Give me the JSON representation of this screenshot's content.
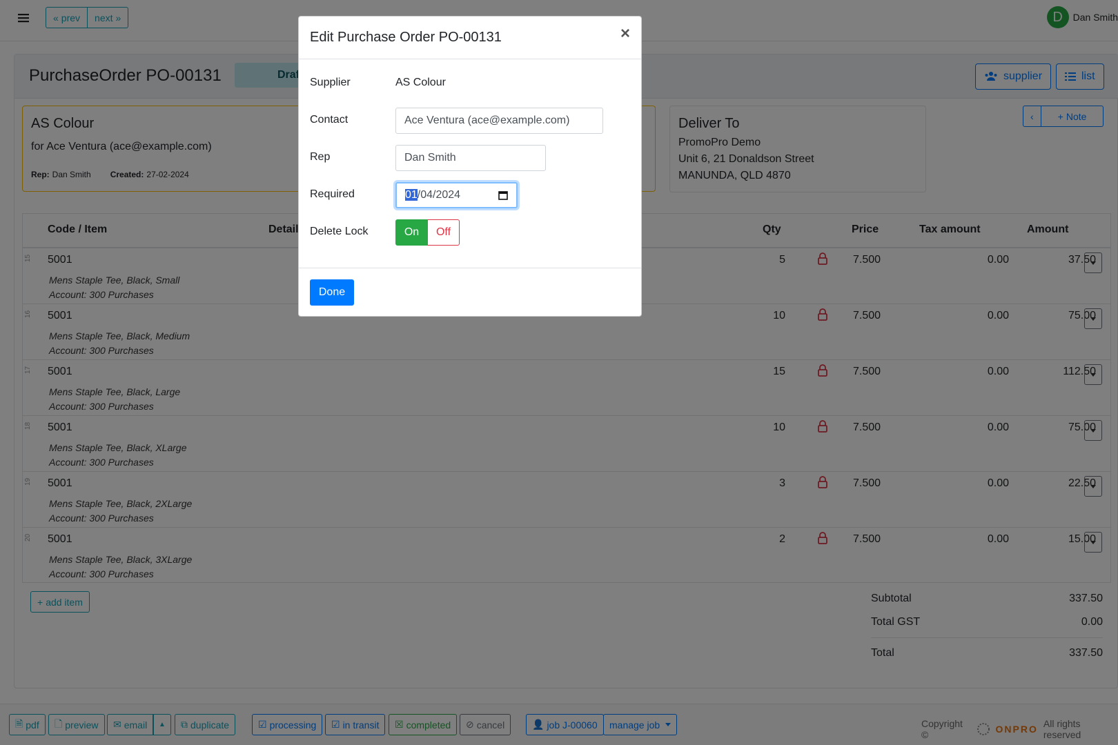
{
  "topbar": {
    "prev_label": "prev",
    "next_label": "next",
    "user_name": "Dan Smith",
    "avatar_letter": "D"
  },
  "page": {
    "title": "PurchaseOrder PO-00131",
    "status": "Draft",
    "supplier_btn": "supplier",
    "list_btn": "list"
  },
  "supplier_card": {
    "name": "AS Colour",
    "for_line": "for Ace Ventura (ace@example.com)",
    "rep_label": "Rep:",
    "rep": "Dan Smith",
    "created_label": "Created:",
    "created": "27-02-2024"
  },
  "deliver_card": {
    "heading": "Deliver To",
    "line1": "PromoPro Demo",
    "line2": "Unit 6, 21 Donaldson Street",
    "line3": "MANUNDA, QLD 4870"
  },
  "note_btn": "Note",
  "table": {
    "headers": {
      "code": "Code / Item",
      "detail": "Detail",
      "qty": "Qty",
      "price": "Price",
      "tax": "Tax amount",
      "amount": "Amount"
    },
    "rows": [
      {
        "num": "15",
        "code": "5001",
        "desc": "Mens Staple Tee, Black, Small",
        "account": "Account: 300 Purchases",
        "qty": "5",
        "price": "7.500",
        "tax": "0.00",
        "amount": "37.50"
      },
      {
        "num": "16",
        "code": "5001",
        "desc": "Mens Staple Tee, Black, Medium",
        "account": "Account: 300 Purchases",
        "qty": "10",
        "price": "7.500",
        "tax": "0.00",
        "amount": "75.00"
      },
      {
        "num": "17",
        "code": "5001",
        "desc": "Mens Staple Tee, Black, Large",
        "account": "Account: 300 Purchases",
        "qty": "15",
        "price": "7.500",
        "tax": "0.00",
        "amount": "112.50"
      },
      {
        "num": "18",
        "code": "5001",
        "desc": "Mens Staple Tee, Black, XLarge",
        "account": "Account: 300 Purchases",
        "qty": "10",
        "price": "7.500",
        "tax": "0.00",
        "amount": "75.00"
      },
      {
        "num": "19",
        "code": "5001",
        "desc": "Mens Staple Tee, Black, 2XLarge",
        "account": "Account: 300 Purchases",
        "qty": "3",
        "price": "7.500",
        "tax": "0.00",
        "amount": "22.50"
      },
      {
        "num": "20",
        "code": "5001",
        "desc": "Mens Staple Tee, Black, 3XLarge",
        "account": "Account: 300 Purchases",
        "qty": "2",
        "price": "7.500",
        "tax": "0.00",
        "amount": "15.00"
      }
    ]
  },
  "add_item_label": "add item",
  "totals": {
    "subtotal_label": "Subtotal",
    "subtotal": "337.50",
    "gst_label": "Total GST",
    "gst": "0.00",
    "total_label": "Total",
    "total": "337.50"
  },
  "footer": {
    "pdf": "pdf",
    "preview": "preview",
    "email": "email",
    "duplicate": "duplicate",
    "processing": "processing",
    "in_transit": "in transit",
    "completed": "completed",
    "cancel": "cancel",
    "job": "job J-00060",
    "manage_job": "manage job",
    "copyright": "Copyright ©",
    "brand": "ONPRO",
    "rights": "All rights reserved"
  },
  "modal": {
    "title": "Edit Purchase Order PO-00131",
    "close": "×",
    "supplier_label": "Supplier",
    "supplier_value": "AS Colour",
    "contact_label": "Contact",
    "contact_value": "Ace Ventura (ace@example.com)",
    "rep_label": "Rep",
    "rep_value": "Dan Smith",
    "required_label": "Required",
    "required_day": "01",
    "required_rest": "/04/2024",
    "delete_lock_label": "Delete Lock",
    "lock_on": "On",
    "lock_off": "Off",
    "done_label": "Done"
  },
  "colors": {
    "primary": "#007bff",
    "info": "#17a2b8",
    "success": "#28a745",
    "danger": "#dc3545",
    "warning": "#ffc107"
  }
}
